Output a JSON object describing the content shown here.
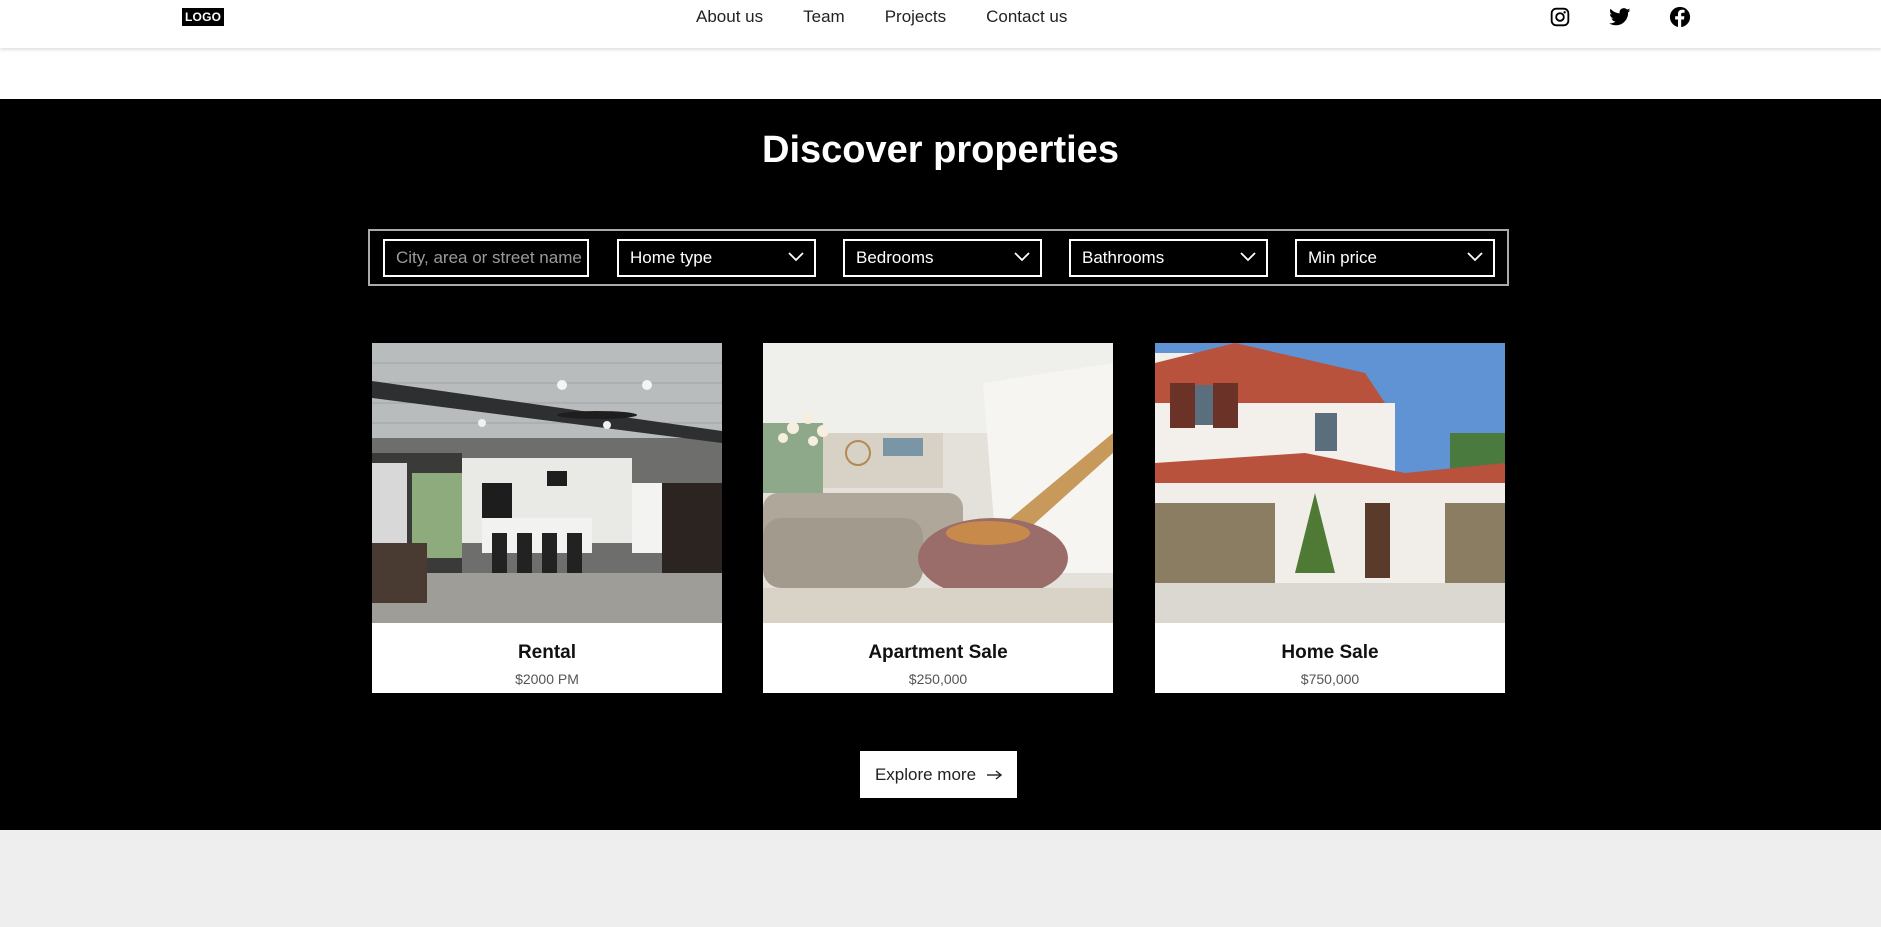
{
  "header": {
    "logo": "LOGO",
    "nav": [
      "About us",
      "Team",
      "Projects",
      "Contact us"
    ],
    "social_icons": [
      "instagram-icon",
      "twitter-icon",
      "facebook-icon"
    ]
  },
  "hero": {
    "title": "Discover properties"
  },
  "filters": {
    "search_placeholder": "City, area or street name",
    "selects": [
      "Home type",
      "Bedrooms",
      "Bathrooms",
      "Min price"
    ]
  },
  "listings": [
    {
      "name": "Rental",
      "price": "$2000 PM"
    },
    {
      "name": "Apartment Sale",
      "price": "$250,000"
    },
    {
      "name": "Home Sale",
      "price": "$750,000"
    }
  ],
  "cta": {
    "label": "Explore more"
  },
  "colors": {
    "dark_bg": "#000000",
    "footer_bg": "#eeeeee",
    "sky": "#5f93d4"
  }
}
